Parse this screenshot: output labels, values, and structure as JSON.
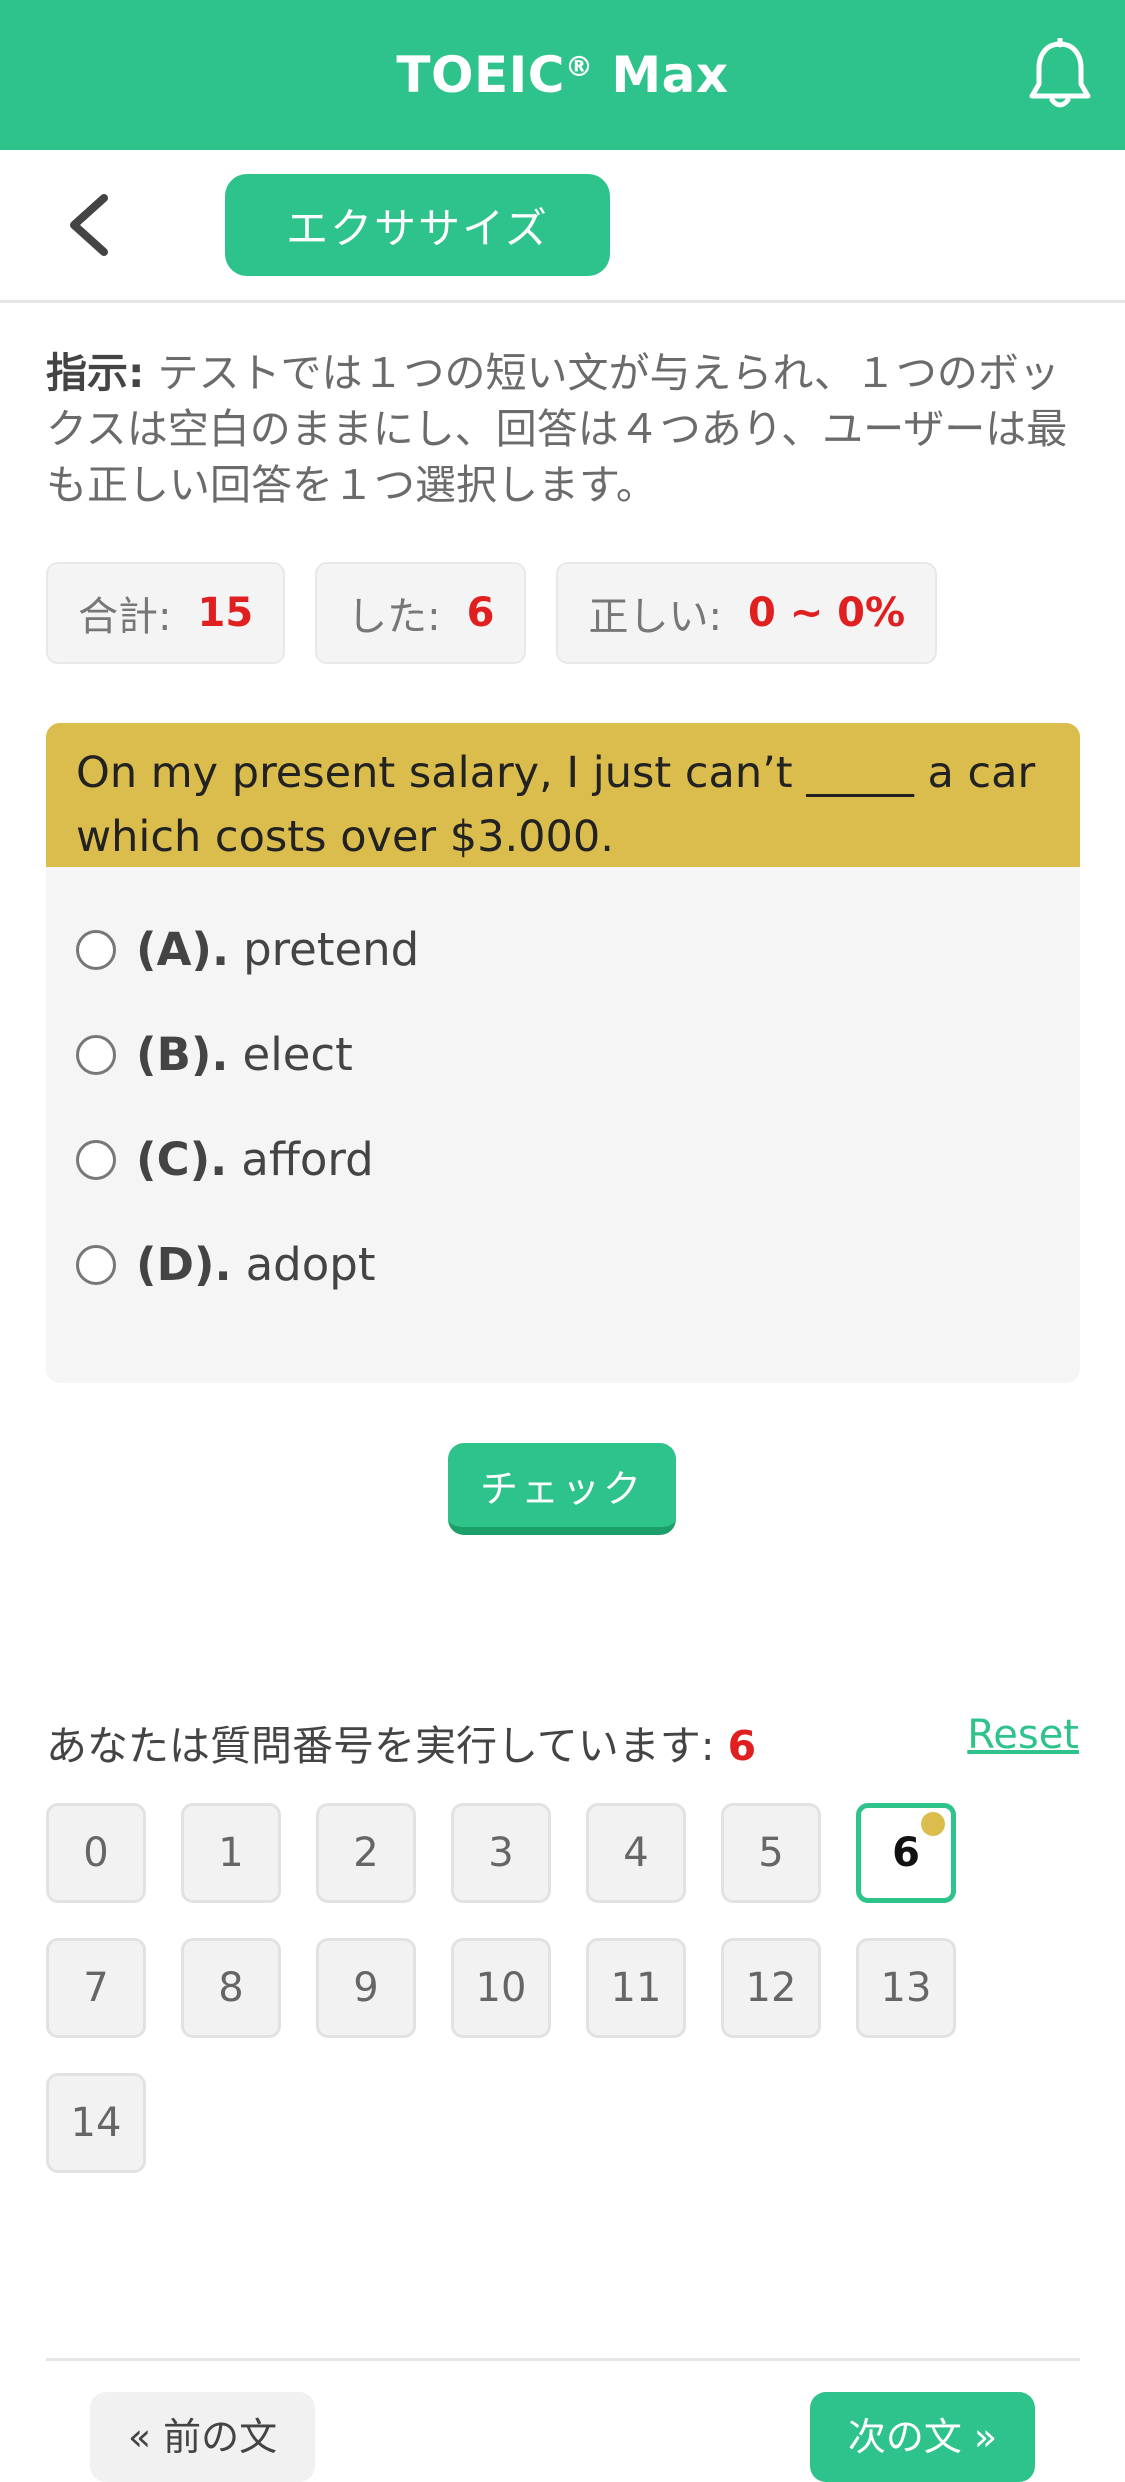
{
  "header": {
    "title": "TOEIC",
    "reg_mark": "®",
    "title_suffix": " Max",
    "bell_icon": "bell-icon"
  },
  "subnav": {
    "back_icon": "chevron-left-icon",
    "tab_label": "エクササイズ"
  },
  "instructions": {
    "label": "指示:",
    "text": " テストでは１つの短い文が与えられ、１つのボックスは空白のままにし、回答は４つあり、ユーザーは最も正しい回答を１つ選択します。"
  },
  "stats": [
    {
      "label": "合計:",
      "value": "15"
    },
    {
      "label": "した:",
      "value": "6"
    },
    {
      "label": "正しい:",
      "value": "0 ~ 0%"
    }
  ],
  "question": {
    "text": "On my present salary, I just can’t _____ a car which costs over $3.000.",
    "options": [
      {
        "letter": "(A).",
        "text": "pretend"
      },
      {
        "letter": "(B).",
        "text": "elect"
      },
      {
        "letter": "(C).",
        "text": "afford"
      },
      {
        "letter": "(D).",
        "text": "adopt"
      }
    ]
  },
  "check_button": "チェック",
  "progress": {
    "label": "あなたは質問番号を実行しています:",
    "current": "6",
    "reset": "Reset",
    "numbers": [
      "0",
      "1",
      "2",
      "3",
      "4",
      "5",
      "6",
      "7",
      "8",
      "9",
      "10",
      "11",
      "12",
      "13",
      "14"
    ]
  },
  "footer": {
    "prev": "« 前の文",
    "next": "次の文 »"
  },
  "colors": {
    "brand": "#2ec38a",
    "question_bg": "#dbbd4d",
    "highlight": "#e02020"
  }
}
